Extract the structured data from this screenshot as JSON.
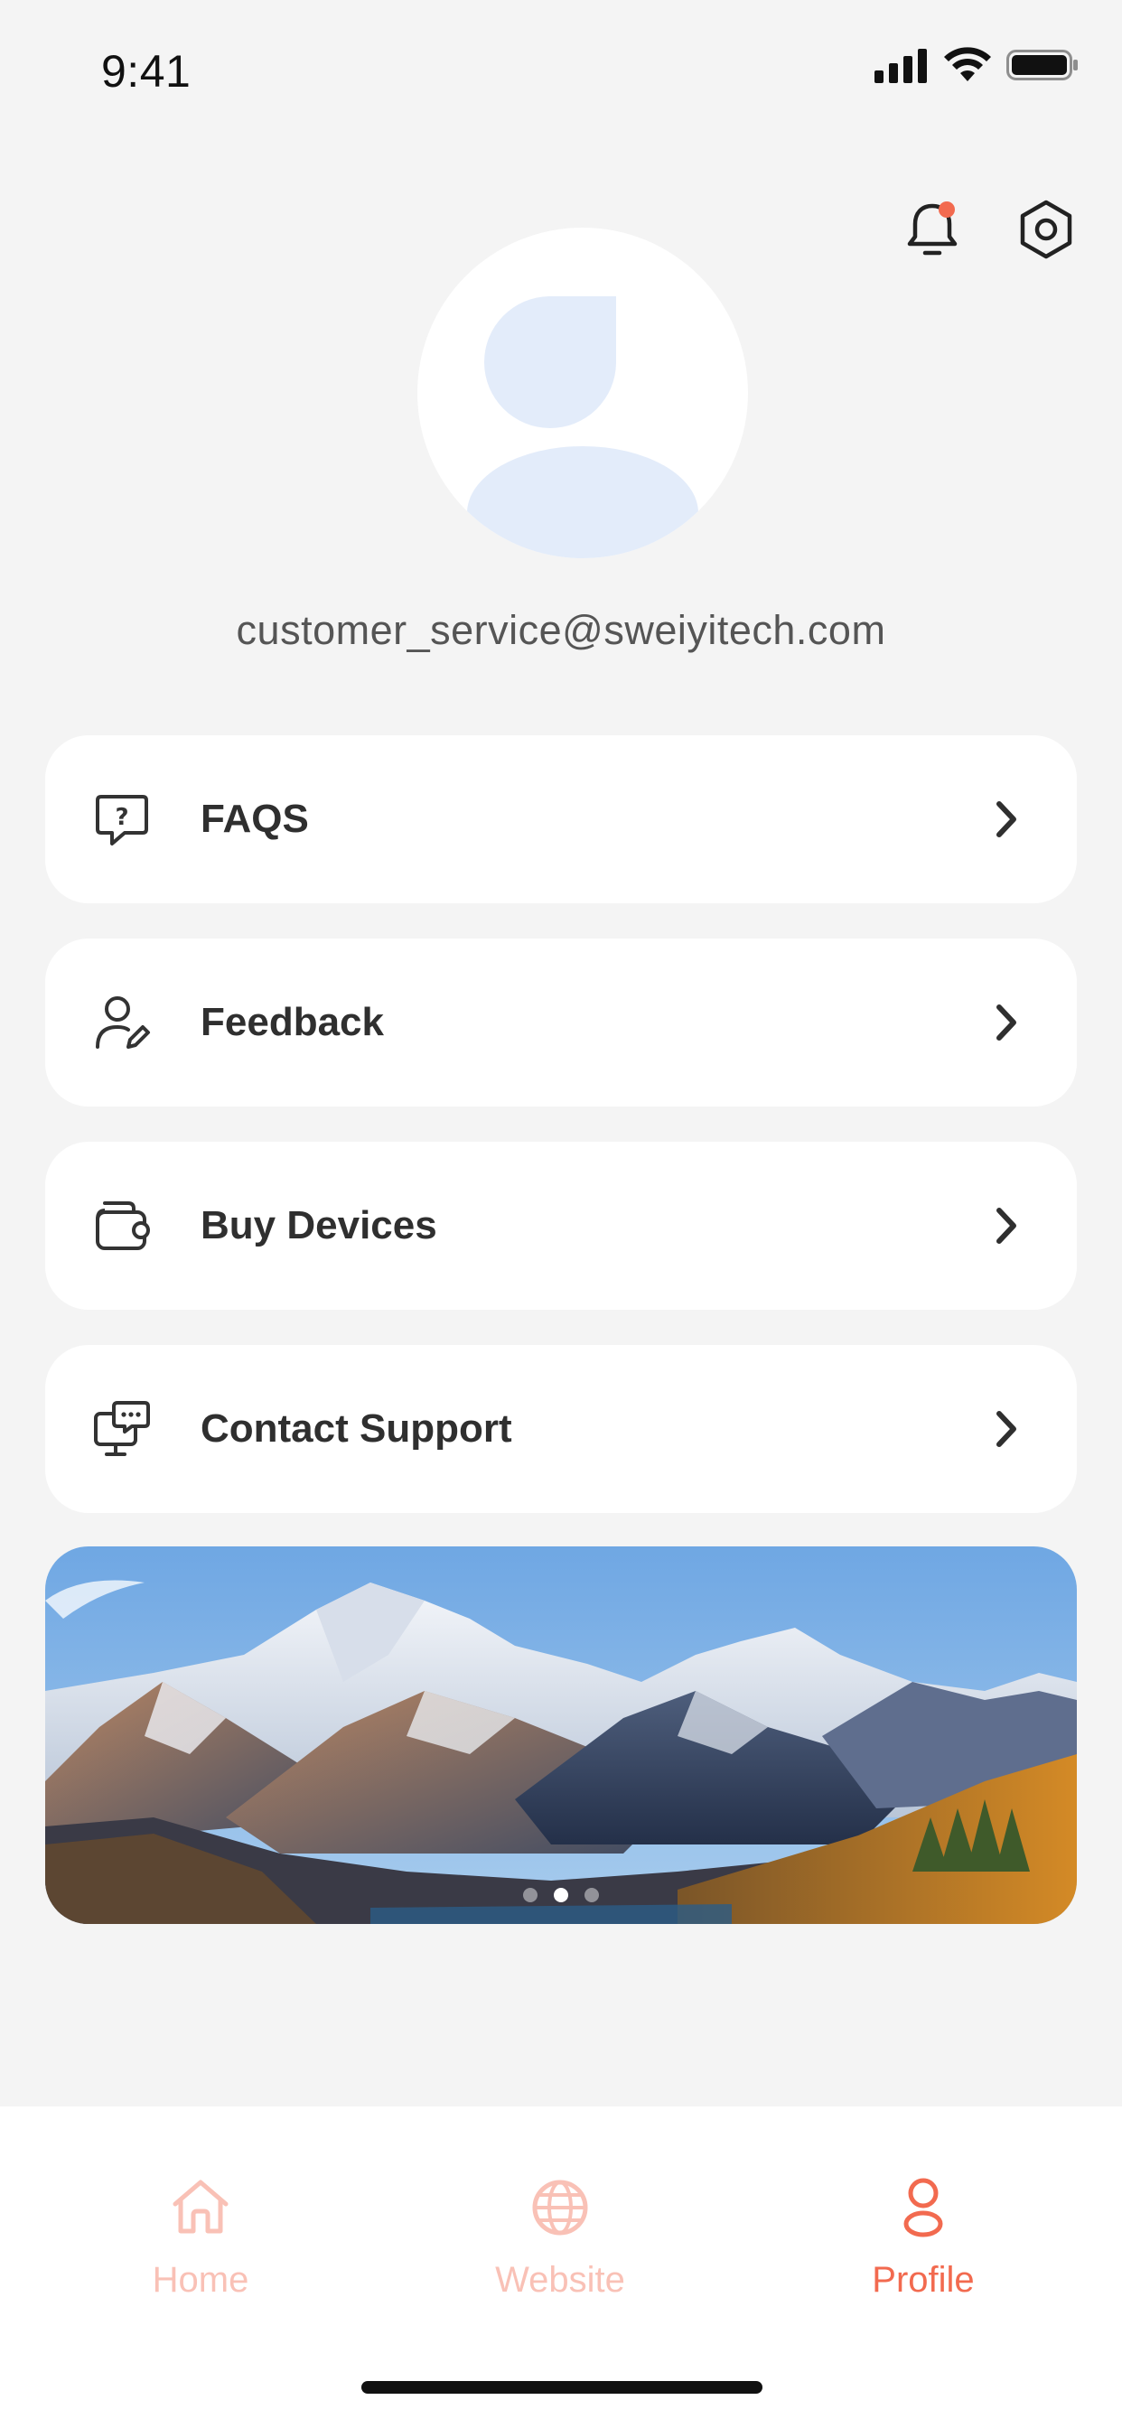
{
  "status_bar": {
    "time": "9:41"
  },
  "header": {
    "notification_badge_color": "#F26A4F"
  },
  "profile": {
    "email": "customer_service@sweiyitech.com"
  },
  "menu": [
    {
      "label": "FAQS",
      "icon": "question-bubble-icon"
    },
    {
      "label": "Feedback",
      "icon": "user-edit-icon"
    },
    {
      "label": "Buy Devices",
      "icon": "wallet-icon"
    },
    {
      "label": "Contact Support",
      "icon": "support-chat-icon"
    }
  ],
  "banner": {
    "slide_count": 3,
    "active_slide": 2
  },
  "tabbar": {
    "tabs": [
      {
        "label": "Home",
        "icon": "home-icon",
        "active": false
      },
      {
        "label": "Website",
        "icon": "globe-icon",
        "active": false
      },
      {
        "label": "Profile",
        "icon": "person-icon",
        "active": true
      }
    ],
    "active_color": "#F26A4F",
    "inactive_color": "#F9C1B6"
  }
}
